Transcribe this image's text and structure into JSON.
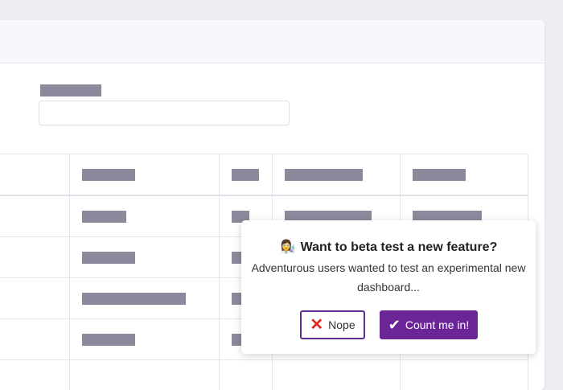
{
  "popup": {
    "emoji": "👩‍🔬",
    "title": "Want to beta test a new feature?",
    "body": "Adventurous users wanted to test an experimental new dashboard...",
    "nope_label": "Nope",
    "nope_icon": "x-icon",
    "count_label": "Count me in!",
    "count_icon": "check-icon"
  },
  "colors": {
    "primary": "#6b2596",
    "nope_border": "#5b2d90",
    "x_icon": "#e0251b",
    "redaction": "#8a8a9c"
  }
}
